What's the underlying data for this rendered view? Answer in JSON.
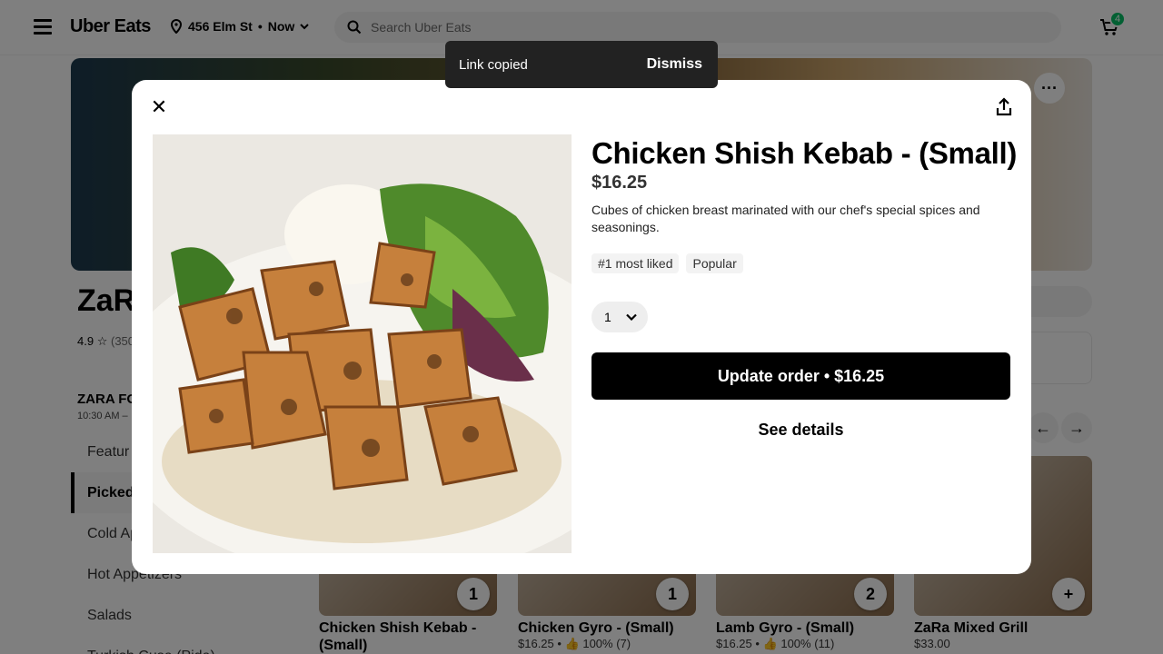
{
  "header": {
    "logo": "Uber Eats",
    "location": "456 Elm St",
    "separator": "•",
    "time": "Now",
    "search_placeholder": "Search Uber Eats",
    "cart_count": "4"
  },
  "store": {
    "name": "ZaRa",
    "rating": "4.9",
    "rating_count": "(350",
    "section_title": "ZARA FO",
    "hours": "10:30 AM –"
  },
  "sidebar": {
    "items": [
      {
        "label": "Featur"
      },
      {
        "label": "Picked"
      },
      {
        "label": "Cold Ap"
      },
      {
        "label": "Hot Appetizers"
      },
      {
        "label": "Salads"
      },
      {
        "label": "Turkish Cuse (Pide)"
      }
    ]
  },
  "cards": [
    {
      "name": "Chicken Shish Kebab - (Small)",
      "meta": "",
      "qty": "1"
    },
    {
      "name": "Chicken Gyro - (Small)",
      "meta": "$16.25 • 👍 100% (7)",
      "qty": "1"
    },
    {
      "name": "Lamb Gyro - (Small)",
      "meta": "$16.25 • 👍 100% (11)",
      "qty": "2"
    },
    {
      "name": "ZaRa Mixed Grill",
      "meta": "$33.00",
      "qty": "+"
    }
  ],
  "toast": {
    "message": "Link copied",
    "action": "Dismiss"
  },
  "modal": {
    "title": "Chicken Shish Kebab - (Small)",
    "price": "$16.25",
    "description": "Cubes of chicken breast marinated with our chef's special spices and seasonings.",
    "tags": [
      "#1 most liked",
      "Popular"
    ],
    "quantity": "1",
    "update_button": "Update order • $16.25",
    "details_button": "See details"
  },
  "colors": {
    "accent": "#06c167",
    "primary_button": "#000000",
    "toast_bg": "#222222"
  }
}
